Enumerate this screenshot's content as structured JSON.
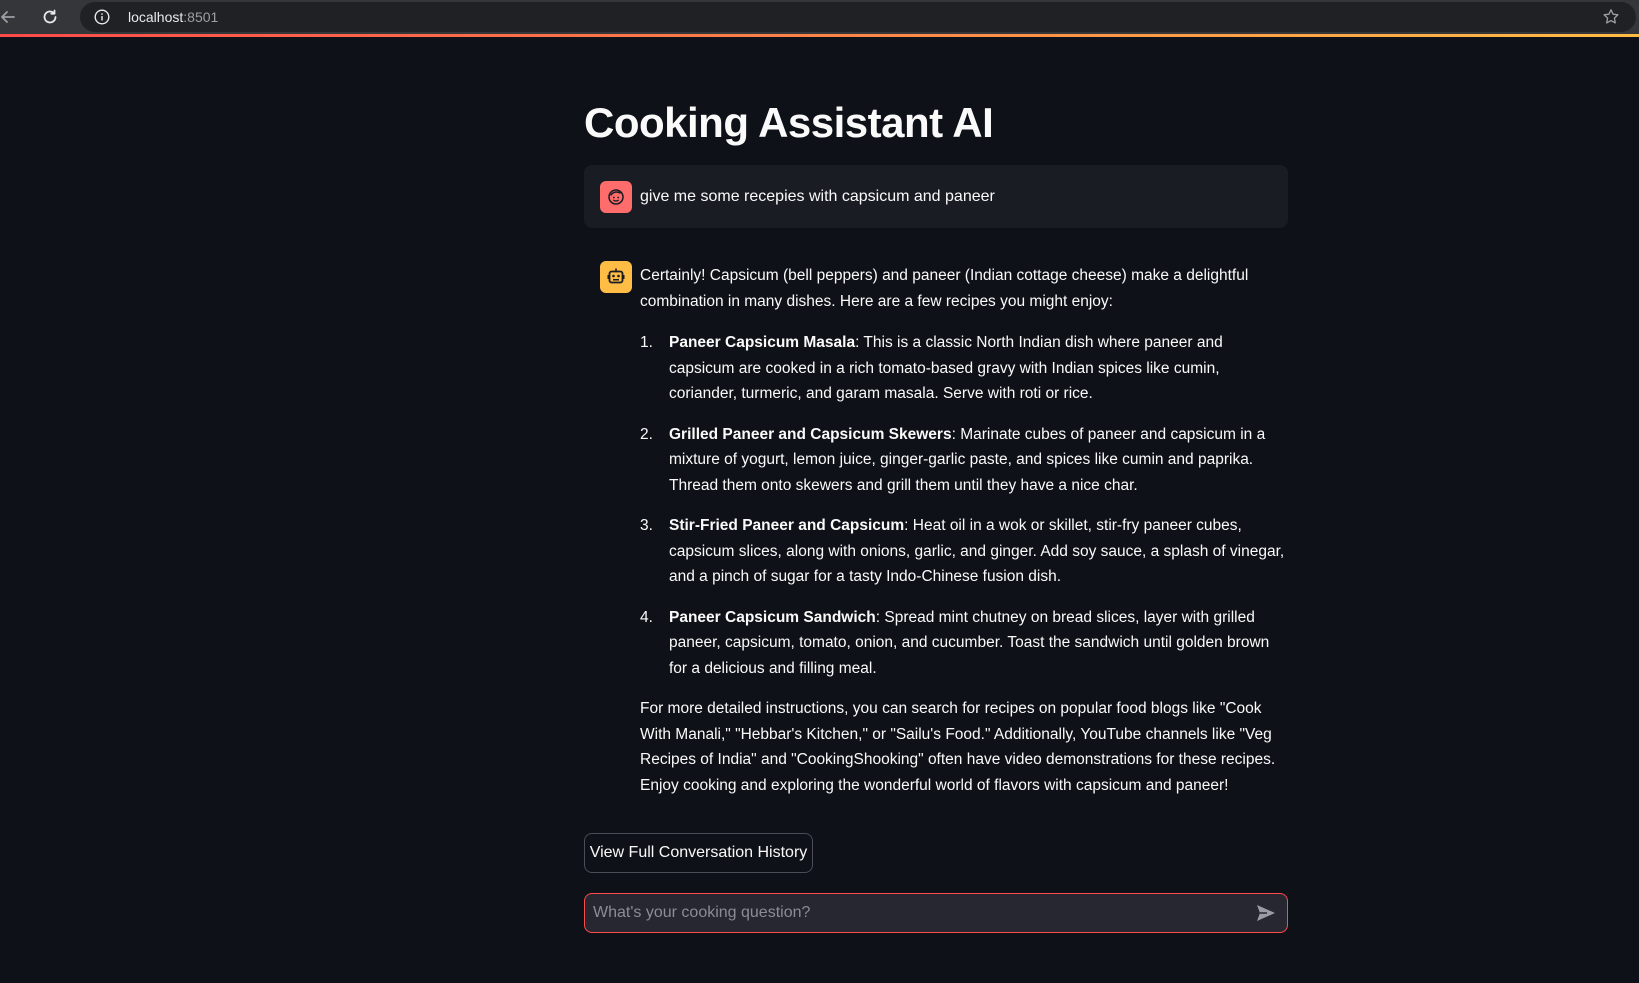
{
  "browser": {
    "url_host": "localhost",
    "url_port": ":8501",
    "icons": [
      "back-arrow-icon",
      "reload-icon",
      "info-icon",
      "star-icon"
    ]
  },
  "page": {
    "title": "Cooking Assistant AI"
  },
  "chat": {
    "user_message": "give me some recepies with capsicum and paneer",
    "assistant_intro": "Certainly! Capsicum (bell peppers) and paneer (Indian cottage cheese) make a delightful combination in many dishes. Here are a few recipes you might enjoy:",
    "recipes": [
      {
        "num": "1.",
        "name": "Paneer Capsicum Masala",
        "text": ": This is a classic North Indian dish where paneer and capsicum are cooked in a rich tomato-based gravy with Indian spices like cumin, coriander, turmeric, and garam masala. Serve with roti or rice."
      },
      {
        "num": "2.",
        "name": "Grilled Paneer and Capsicum Skewers",
        "text": ": Marinate cubes of paneer and capsicum in a mixture of yogurt, lemon juice, ginger-garlic paste, and spices like cumin and paprika. Thread them onto skewers and grill them until they have a nice char."
      },
      {
        "num": "3.",
        "name": "Stir-Fried Paneer and Capsicum",
        "text": ": Heat oil in a wok or skillet, stir-fry paneer cubes, capsicum slices, along with onions, garlic, and ginger. Add soy sauce, a splash of vinegar, and a pinch of sugar for a tasty Indo-Chinese fusion dish."
      },
      {
        "num": "4.",
        "name": "Paneer Capsicum Sandwich",
        "text": ": Spread mint chutney on bread slices, layer with grilled paneer, capsicum, tomato, onion, and cucumber. Toast the sandwich until golden brown for a delicious and filling meal."
      }
    ],
    "assistant_outro": "For more detailed instructions, you can search for recipes on popular food blogs like \"Cook With Manali,\" \"Hebbar's Kitchen,\" or \"Sailu's Food.\" Additionally, YouTube channels like \"Veg Recipes of India\" and \"CookingShooking\" often have video demonstrations for these recipes. Enjoy cooking and exploring the wonderful world of flavors with capsicum and paneer!",
    "user_avatar_color": "#ff6c6c",
    "assistant_avatar_color": "#ffbd45"
  },
  "controls": {
    "history_button_label": "View Full Conversation History",
    "input_placeholder": "What's your cooking question?",
    "input_value": "",
    "input_border_color": "#ff4b4b"
  }
}
